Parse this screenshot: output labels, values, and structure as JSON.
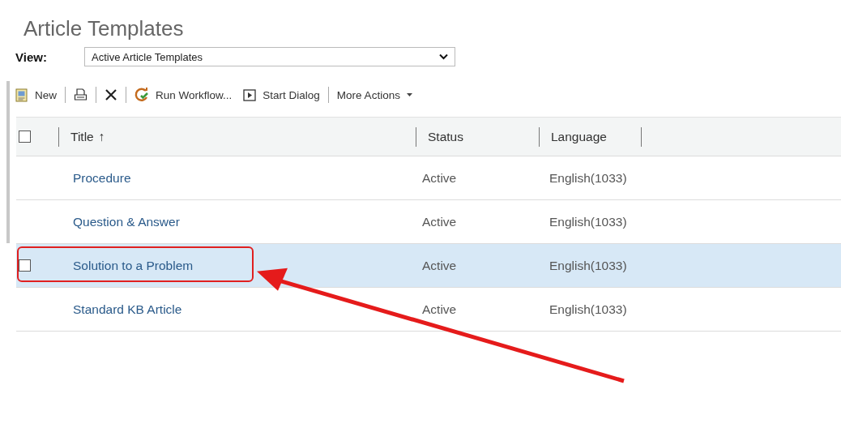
{
  "page": {
    "title": "Article Templates"
  },
  "view": {
    "label": "View:",
    "value": "Active Article Templates"
  },
  "toolbar": [
    {
      "kind": "new",
      "label": "New"
    },
    {
      "kind": "separator"
    },
    {
      "kind": "print"
    },
    {
      "kind": "separator"
    },
    {
      "kind": "delete"
    },
    {
      "kind": "separator"
    },
    {
      "kind": "workflow",
      "label": "Run Workflow..."
    },
    {
      "kind": "dialog",
      "label": "Start Dialog"
    },
    {
      "kind": "separator"
    },
    {
      "kind": "menu",
      "label": "More Actions"
    }
  ],
  "table": {
    "select_all_checked": false,
    "columns": [
      {
        "label": "Title",
        "sort_indicator": "↑"
      },
      {
        "label": "Status"
      },
      {
        "label": "Language"
      }
    ],
    "rows": [
      {
        "title": "Procedure",
        "status": "Active",
        "language": "English(1033)",
        "selected": false,
        "annotated": false
      },
      {
        "title": "Question & Answer",
        "status": "Active",
        "language": "English(1033)",
        "selected": false,
        "annotated": false
      },
      {
        "title": "Solution to a Problem",
        "status": "Active",
        "language": "English(1033)",
        "selected": true,
        "checked": false,
        "annotated": true
      },
      {
        "title": "Standard KB Article",
        "status": "Active",
        "language": "English(1033)",
        "selected": false,
        "annotated": false
      }
    ]
  }
}
